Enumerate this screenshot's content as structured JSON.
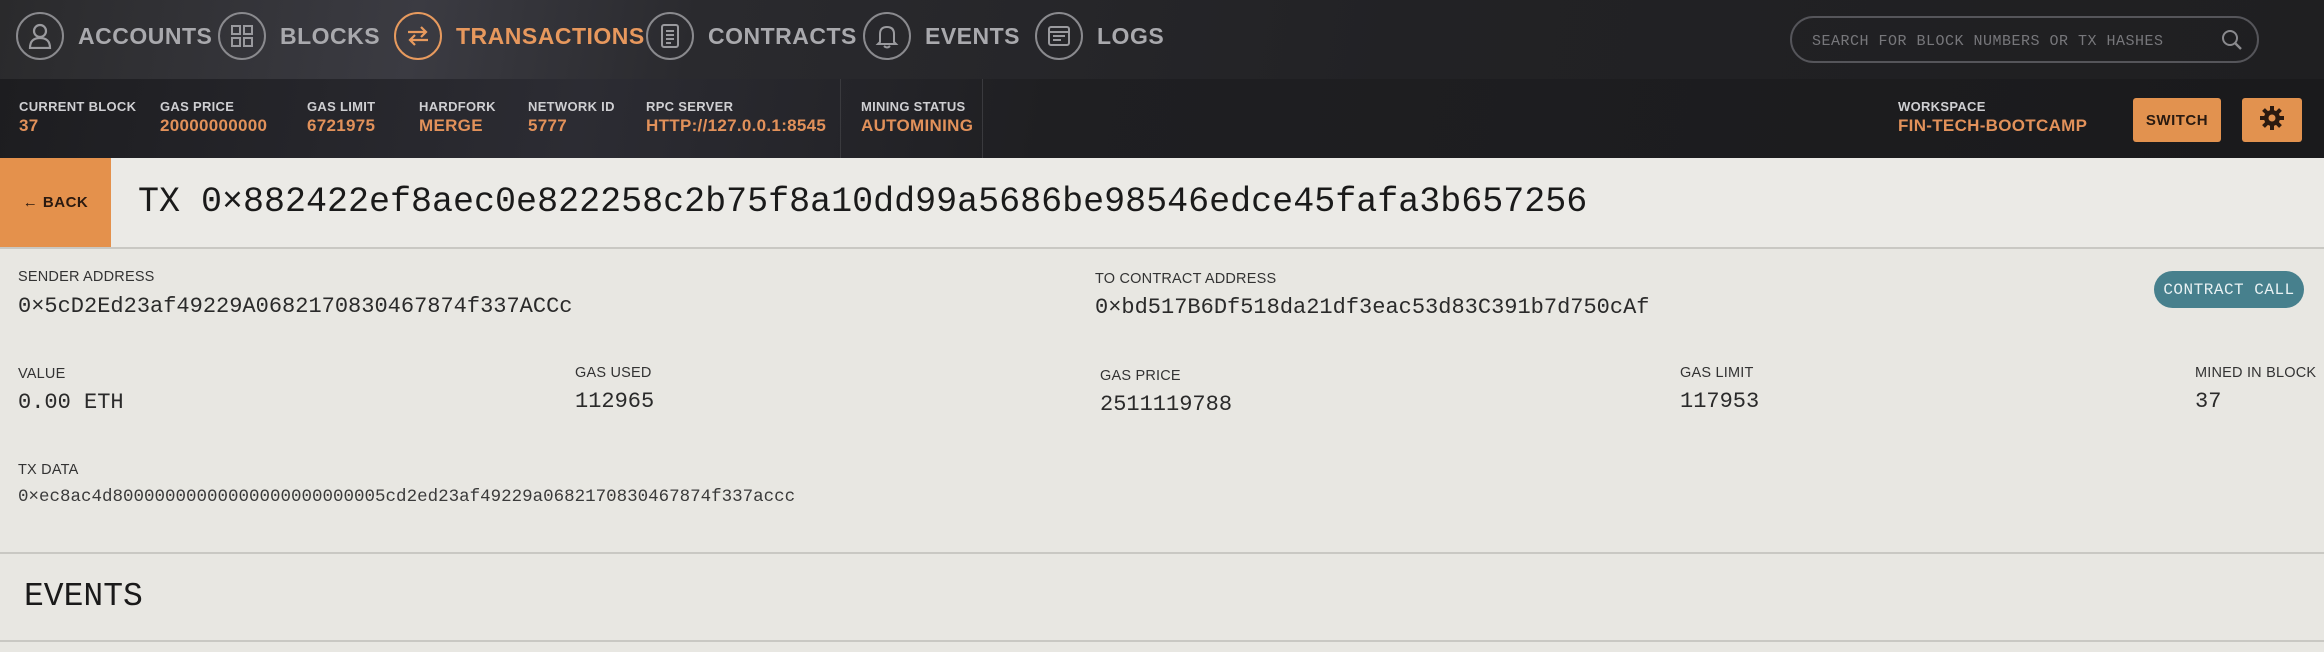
{
  "nav": {
    "items": [
      {
        "label": "ACCOUNTS",
        "icon": "person-icon"
      },
      {
        "label": "BLOCKS",
        "icon": "grid-icon"
      },
      {
        "label": "TRANSACTIONS",
        "icon": "swap-arrows-icon",
        "active": true
      },
      {
        "label": "CONTRACTS",
        "icon": "document-icon"
      },
      {
        "label": "EVENTS",
        "icon": "bell-icon"
      },
      {
        "label": "LOGS",
        "icon": "terminal-icon"
      }
    ],
    "search_placeholder": "SEARCH FOR BLOCK NUMBERS OR TX HASHES"
  },
  "status": {
    "current_block": {
      "label": "CURRENT BLOCK",
      "value": "37"
    },
    "gas_price": {
      "label": "GAS PRICE",
      "value": "20000000000"
    },
    "gas_limit": {
      "label": "GAS LIMIT",
      "value": "6721975"
    },
    "hardfork": {
      "label": "HARDFORK",
      "value": "MERGE"
    },
    "network_id": {
      "label": "NETWORK ID",
      "value": "5777"
    },
    "rpc_server": {
      "label": "RPC SERVER",
      "value": "HTTP://127.0.0.1:8545"
    },
    "mining_status": {
      "label": "MINING STATUS",
      "value": "AUTOMINING"
    },
    "workspace": {
      "label": "WORKSPACE",
      "value": "FIN-TECH-BOOTCAMP"
    },
    "switch_label": "SWITCH"
  },
  "tx": {
    "back_label": "← BACK",
    "title": "TX 0×882422ef8aec0e822258c2b75f8a10dd99a5686be98546edce45fafa3b657256",
    "sender": {
      "label": "SENDER ADDRESS",
      "value": "0×5cD2Ed23af49229A0682170830467874f337ACCc"
    },
    "to_contract": {
      "label": "TO CONTRACT ADDRESS",
      "value": "0×bd517B6Df518da21df3eac53d83C391b7d750cAf"
    },
    "badge": "CONTRACT CALL",
    "value": {
      "label": "VALUE",
      "value": "0.00 ETH"
    },
    "gas_used": {
      "label": "GAS USED",
      "value": "112965"
    },
    "gas_price": {
      "label": "GAS PRICE",
      "value": "2511119788"
    },
    "gas_limit": {
      "label": "GAS LIMIT",
      "value": "117953"
    },
    "mined_in_block": {
      "label": "MINED IN BLOCK",
      "value": "37"
    },
    "tx_data": {
      "label": "TX DATA",
      "value": "0×ec8ac4d80000000000000000000000005cd2ed23af49229a0682170830467874f337accc"
    }
  },
  "events": {
    "title": "EVENTS"
  },
  "colors": {
    "accent": "#e2924f",
    "badge": "#47808d",
    "nav_bg": "#2a2a2c"
  }
}
